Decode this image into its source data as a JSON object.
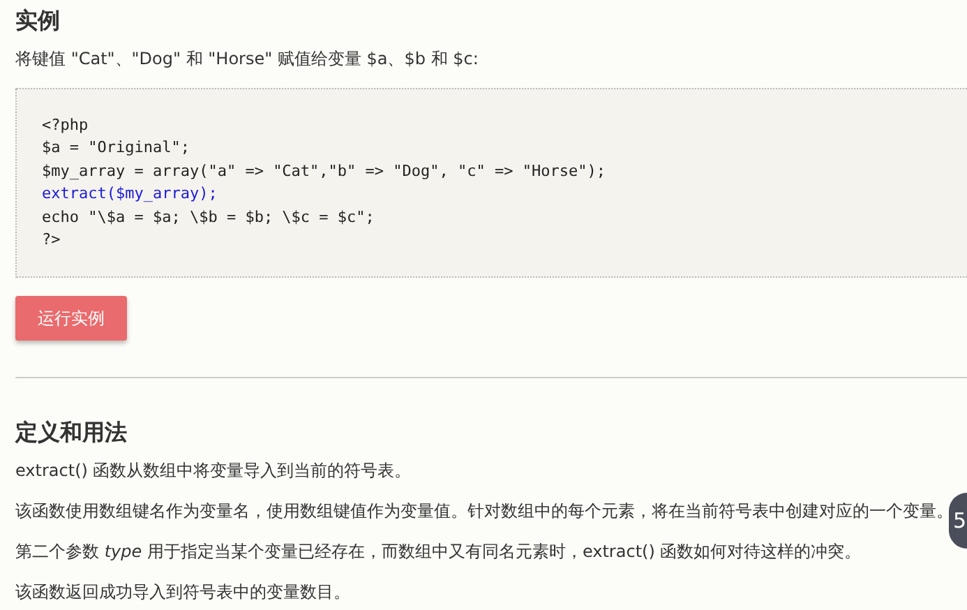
{
  "example": {
    "heading": "实例",
    "intro": "将键值 \"Cat\"、\"Dog\" 和 \"Horse\" 赋值给变量 $a、$b 和 $c:",
    "code": [
      {
        "kind": "plain",
        "text": "<?php"
      },
      {
        "kind": "plain",
        "text": "$a = \"Original\";"
      },
      {
        "kind": "plain",
        "text": "$my_array = array(\"a\" => \"Cat\",\"b\" => \"Dog\", \"c\" => \"Horse\");"
      },
      {
        "kind": "function",
        "text": "extract($my_array);"
      },
      {
        "kind": "plain",
        "text": "echo \"\\$a = $a; \\$b = $b; \\$c = $c\";"
      },
      {
        "kind": "plain",
        "text": "?>"
      }
    ],
    "run_button": "运行实例"
  },
  "definition": {
    "heading": "定义和用法",
    "paragraphs": [
      "extract() 函数从数组中将变量导入到当前的符号表。",
      "该函数使用数组键名作为变量名，使用数组键值作为变量值。针对数组中的每个元素，将在当前符号表中创建对应的一个变量。",
      "第二个参数 *type* 用于指定当某个变量已经存在，而数组中又有同名元素时，extract() 函数如何对待这样的冲突。",
      "该函数返回成功导入到符号表中的变量数目。"
    ]
  },
  "floating_badge": {
    "text": "5"
  }
}
